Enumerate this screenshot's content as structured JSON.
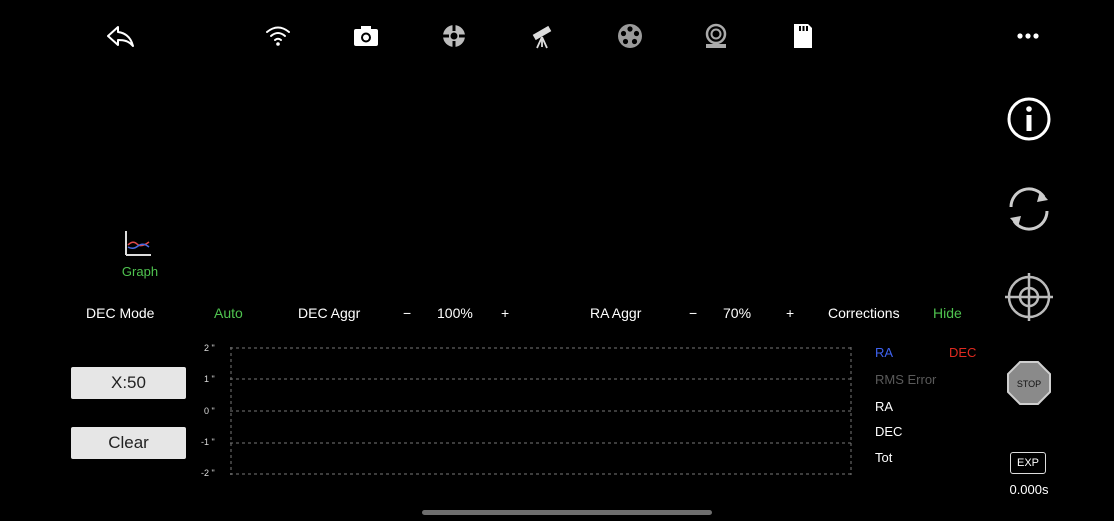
{
  "toolbar": {
    "icons": [
      "back-arrow-icon",
      "wifi-icon",
      "camera-icon",
      "target-icon",
      "telescope-icon",
      "filter-wheel-icon",
      "focuser-icon",
      "sd-card-icon",
      "more-icon"
    ]
  },
  "graph_button": {
    "label": "Graph"
  },
  "controls": {
    "dec_mode_label": "DEC Mode",
    "dec_mode_value": "Auto",
    "dec_aggr_label": "DEC Aggr",
    "dec_aggr_minus": "−",
    "dec_aggr_value": "100%",
    "dec_aggr_plus": "+",
    "ra_aggr_label": "RA Aggr",
    "ra_aggr_minus": "−",
    "ra_aggr_value": "70%",
    "ra_aggr_plus": "+",
    "corrections_label": "Corrections",
    "corrections_value": "Hide"
  },
  "buttons": {
    "x_scale": "X:50",
    "clear": "Clear"
  },
  "plot": {
    "y_ticks": [
      "2 \"",
      "1 \"",
      "0 \"",
      "-1 \"",
      "-2 \""
    ]
  },
  "legend": {
    "ra": "RA",
    "dec": "DEC",
    "rms_error": "RMS Error",
    "ra_row": "RA",
    "dec_row": "DEC",
    "tot_row": "Tot"
  },
  "sidebar": {
    "icons": [
      "info-icon",
      "refresh-icon",
      "crosshair-icon",
      "stop-icon"
    ],
    "stop_label": "STOP",
    "exp_label": "EXP",
    "exposure_value": "0.000s"
  },
  "colors": {
    "green": "#4fc34f",
    "ra_blue": "#3e62f0",
    "dec_red": "#e02a20",
    "grey": "#5a5a5a"
  }
}
